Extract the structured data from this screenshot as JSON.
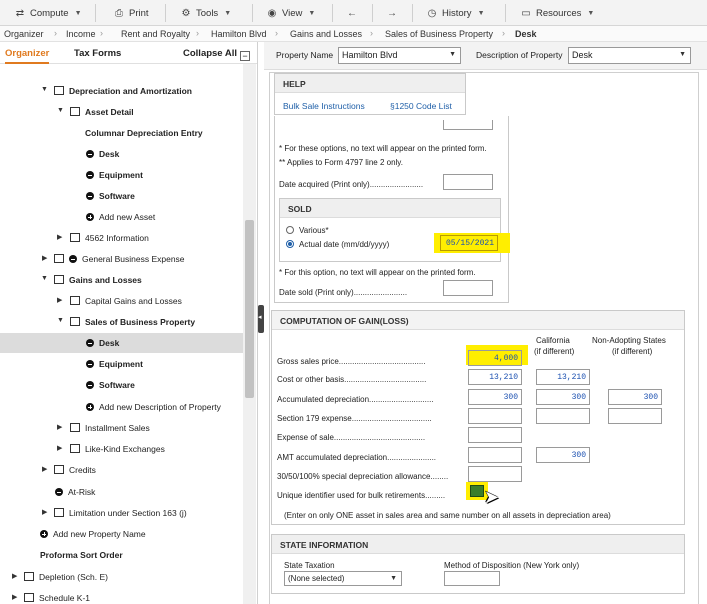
{
  "toolbar": {
    "compute": "Compute",
    "print": "Print",
    "tools": "Tools",
    "view": "View",
    "history": "History",
    "resources": "Resources"
  },
  "breadcrumb": [
    "Organizer",
    "Income",
    "Rent and Royalty",
    "Hamilton Blvd",
    "Gains and Losses",
    "Sales of Business Property",
    "Desk"
  ],
  "left": {
    "tab_organizer": "Organizer",
    "tab_tax_forms": "Tax Forms",
    "collapse_all": "Collapse All",
    "collapse_icon": "−",
    "tree": [
      {
        "label": "Depreciation and Amortization",
        "bold": true
      },
      {
        "label": "Asset Detail",
        "bold": true
      },
      {
        "label": "Columnar Depreciation Entry",
        "bold": true
      },
      {
        "label": "Desk",
        "bold": true
      },
      {
        "label": "Equipment",
        "bold": true
      },
      {
        "label": "Software",
        "bold": true
      },
      {
        "label": "Add new Asset",
        "bold": false
      },
      {
        "label": "4562 Information",
        "bold": false
      },
      {
        "label": "General Business Expense",
        "bold": false
      },
      {
        "label": "Gains and Losses",
        "bold": true
      },
      {
        "label": "Capital Gains and Losses",
        "bold": false
      },
      {
        "label": "Sales of Business Property",
        "bold": true
      },
      {
        "label": "Desk",
        "bold": true
      },
      {
        "label": "Equipment",
        "bold": true
      },
      {
        "label": "Software",
        "bold": true
      },
      {
        "label": "Add new Description of Property",
        "bold": false
      },
      {
        "label": "Installment Sales",
        "bold": false
      },
      {
        "label": "Like-Kind Exchanges",
        "bold": false
      },
      {
        "label": "Credits",
        "bold": false
      },
      {
        "label": "At-Risk",
        "bold": false
      },
      {
        "label": "Limitation under Section 163 (j)",
        "bold": false
      },
      {
        "label": "Add new Property Name",
        "bold": false
      },
      {
        "label": "Proforma Sort Order",
        "bold": true
      },
      {
        "label": "Depletion (Sch. E)",
        "bold": false
      },
      {
        "label": "Schedule K-1",
        "bold": false
      }
    ]
  },
  "property": {
    "name_label": "Property Name",
    "name_value": "Hamilton Blvd",
    "desc_label": "Description of Property",
    "desc_value": "Desk"
  },
  "help": {
    "title": "HELP",
    "link1": "Bulk Sale Instructions",
    "link2": "§1250 Code List"
  },
  "acquired": {
    "note1": "* For these options, no text will appear on the printed form.",
    "note2": "** Applies to Form 4797 line 2 only.",
    "date_label": "Date acquired (Print only)........................"
  },
  "sold": {
    "title": "SOLD",
    "various": "Various*",
    "actual": "Actual date (mm/dd/yyyy)",
    "actual_value": "05/15/2021",
    "note": "* For this option, no text will appear on the printed form.",
    "date_sold_label": "Date sold (Print only)........................"
  },
  "computation": {
    "title": "COMPUTATION OF GAIN(LOSS)",
    "col_ca": "California",
    "col_ca_sub": "(if different)",
    "col_na": "Non-Adopting States",
    "col_na_sub": "(if different)",
    "rows": [
      {
        "label": "Gross sales price.......................................",
        "fed": "4,000",
        "ca": "",
        "na": ""
      },
      {
        "label": "Cost or other basis.....................................",
        "fed": "13,210",
        "ca": "13,210",
        "na": ""
      },
      {
        "label": "Accumulated depreciation.............................",
        "fed": "300",
        "ca": "300",
        "na": "300"
      },
      {
        "label": "Section 179 expense....................................",
        "fed": "",
        "ca": "",
        "na": ""
      },
      {
        "label": "Expense of sale.........................................",
        "fed": "",
        "ca": "",
        "na": ""
      },
      {
        "label": "AMT accumulated depreciation......................",
        "fed": "",
        "ca": "300",
        "na": ""
      },
      {
        "label": "30/50/100% special depreciation allowance........",
        "fed": "",
        "ca": "",
        "na": ""
      },
      {
        "label": "Unique identifier used for bulk retirements.........",
        "fed": "",
        "ca": "",
        "na": ""
      }
    ],
    "footnote": "(Enter on only ONE asset in sales area and same number on all assets in depreciation area)"
  },
  "state": {
    "title": "STATE INFORMATION",
    "taxation_label": "State Taxation",
    "taxation_value": "(None selected)",
    "method_label": "Method of Disposition (New York only)"
  },
  "colors": {
    "highlight": "#ffee00",
    "accent": "#e07a1f",
    "link": "#1f5fa8"
  }
}
